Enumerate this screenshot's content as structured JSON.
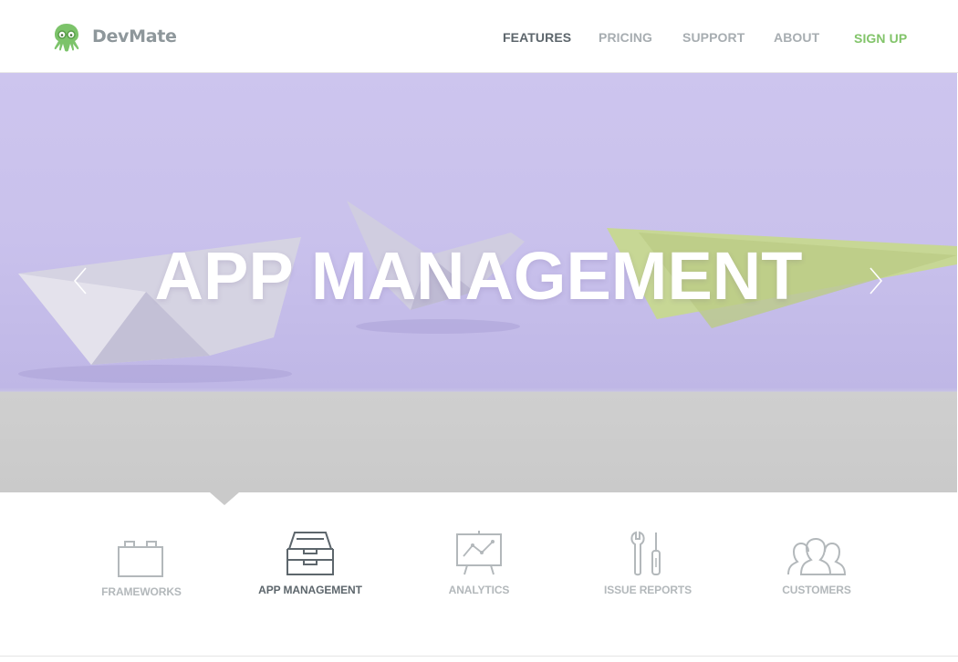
{
  "brand": {
    "name": "DevMate",
    "logo_icon": "octopus-glasses-icon",
    "logo_color": "#7cc36a"
  },
  "nav": {
    "items": [
      {
        "label": "FEATURES",
        "active": true
      },
      {
        "label": "PRICING",
        "active": false
      },
      {
        "label": "SUPPORT",
        "active": false
      },
      {
        "label": "ABOUT",
        "active": false
      }
    ],
    "signup": "SIGN UP",
    "signup_color": "#82c46a"
  },
  "hero": {
    "title": "APP MANAGEMENT",
    "prev_icon": "chevron-left-icon",
    "next_icon": "chevron-right-icon"
  },
  "tabs": [
    {
      "label": "FRAMEWORKS",
      "icon": "lego-brick-icon",
      "active": false
    },
    {
      "label": "APP MANAGEMENT",
      "icon": "drawer-cabinet-icon",
      "active": true
    },
    {
      "label": "ANALYTICS",
      "icon": "presentation-chart-icon",
      "active": false
    },
    {
      "label": "ISSUE REPORTS",
      "icon": "wrench-screwdriver-icon",
      "active": false
    },
    {
      "label": "CUSTOMERS",
      "icon": "users-group-icon",
      "active": false
    }
  ]
}
